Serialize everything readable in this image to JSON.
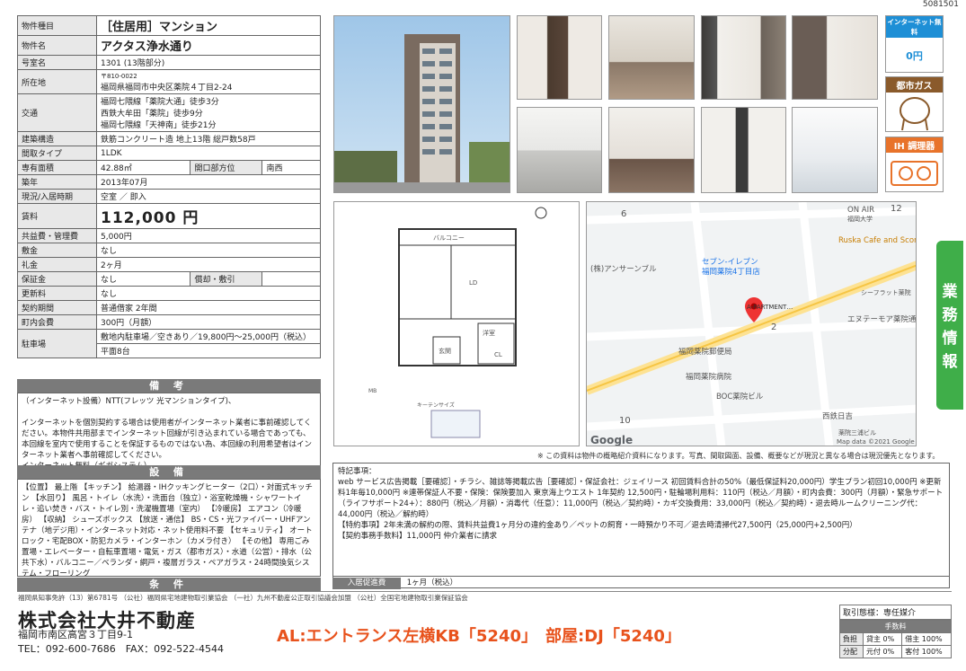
{
  "doc_id": "5081501",
  "spec": {
    "type_label": "物件種目",
    "type_value": "［住居用］マンション",
    "name_label": "物件名",
    "name_value": "アクタス浄水通り",
    "room_label": "号室名",
    "room_value": "1301 (13階部分)",
    "addr_label": "所在地",
    "zip": "〒810-0022",
    "addr_value": "福岡県福岡市中央区薬院４丁目2-24",
    "access_label": "交通",
    "access": [
      "福岡七隈線「薬院大通」徒歩3分",
      "西鉄大牟田「薬院」徒歩9分",
      "福岡七隈線「天神南」徒歩21分"
    ],
    "struct_label": "建築構造",
    "struct_value": "鉄筋コンクリート造 地上13階 総戸数58戸",
    "layout_label": "間取タイプ",
    "layout_value": "1LDK",
    "area_label": "専有面積",
    "area_value": "42.88㎡",
    "face_label": "開口部方位",
    "face_value": "南西",
    "built_label": "築年",
    "built_value": "2013年07月",
    "status_label": "現況/入居時期",
    "status_value": "空室 ／ 即入",
    "rent_label": "賃料",
    "rent_value": "112,000 円",
    "fee_label": "共益費・管理費",
    "fee_value": "5,000円",
    "deposit_label": "敷金",
    "deposit_value": "なし",
    "key_label": "礼金",
    "key_value": "2ヶ月",
    "hosho_label": "保証金",
    "hosho_value": "なし",
    "shokyaku_label": "償却・敷引",
    "shokyaku_value": "",
    "renew_label": "更新料",
    "renew_value": "なし",
    "contract_label": "契約期間",
    "contract_value": "普通借家 2年間",
    "town_label": "町内会費",
    "town_value": "300円（月額）",
    "parking_label": "駐車場",
    "parking_value1": "敷地内駐車場／空きあり／19,800円〜25,000円（税込）",
    "parking_value2": "平面8台"
  },
  "remarks": {
    "title": "備 考",
    "text": "（インターネット設備）NTT(フレッツ 光マンションタイプ)、\n\nインターネットを個別契約する場合は使用者がインターネット業者に事前確認してください。本物件共用部までインターネット回線が引き込まれている場合であっても、本回線を室内で使用することを保証するものではない為、本回線の利用希望者はインターネット業者へ事前確認してください。\nインターネット無料（ギガシステム）"
  },
  "equipment": {
    "title": "設 備",
    "text": "【位置】 最上階 【キッチン】 給湯器・IHクッキングヒーター（2口）・対面式キッチン 【水回り】 風呂・トイレ（水洗）・洗面台（独立）・浴室乾燥機・シャワートイレ・追い焚き・バス・トイレ別・洗濯機置場（室内） 【冷暖房】 エアコン（冷暖房） 【収納】 シューズボックス 【放送・通信】 BS・CS・光ファイバー・UHFアンテナ（地デジ用）・インターネット対応・ネット使用料不要 【セキュリティ】 オートロック・宅配BOX・防犯カメラ・インターホン（カメラ付き） 【その他】 専用ごみ置場・エレベーター・自転車置場・電気・ガス（都市ガス）・水道（公営）・排水（公共下水）・バルコニー／ベランダ・網戸・複層ガラス・ペアガラス・24時間換気システム・フローリング"
  },
  "conditions": {
    "title": "条 件",
    "text": ""
  },
  "badges": {
    "internet": "インターネット無料",
    "internet_price": "0円",
    "gas": "都市ガス",
    "ih": "IH 調理器"
  },
  "side_tab": [
    "業",
    "務",
    "情",
    "報"
  ],
  "map": {
    "labels": [
      "ON AIR",
      "福岡大学",
      "Ruska Cafe and Scones",
      "セブン-イレブン",
      "福岡薬院4丁目店",
      "福岡薬院病院",
      "エヌテーモア薬院通り",
      "シーフラット薬院",
      "福岡薬院郵便局",
      "BOC薬院ビル",
      "西鉄日吉",
      "薬院三浦ビル",
      "12",
      "6",
      "10",
      "2",
      "Google",
      "Map data ©2021 Google",
      "(株)アンサーンブル"
    ],
    "pin": "A-PARTMENT…"
  },
  "floorplan": {
    "labels": [
      "バルコニー",
      "LD",
      "洋室",
      "CL",
      "玄関",
      "キーテンサイズ",
      "MB"
    ]
  },
  "photo_note": "※ この資料は物件の概略紹介資料になります。写真、間取図面、設備、概要などが現況と異なる場合は現況優先となります。",
  "special": {
    "title": "特記事項：",
    "text": "web サービス広告掲載［要確認］・チラシ、雑誌等掲載広告［要確認］・保証会社：ジェイリース 初回賃料合計の50%（最低保証料20,000円）学生プラン初回10,000円 ※更新料1年毎10,000円 ※連帯保証人不要・保険：保険要加入 東京海上ウエスト 1年契約 12,500円・駐輪場利用料：110円（税込／月額）・町内会費：300円（月額）・緊急サポート（ライフサポート24+）：880円（税込／月額）・消毒代（任意）：11,000円（税込／契約時）・カギ交換費用：33,000円（税込／契約時）・退去時ルームクリーニング代：44,000円（税込／解約時）\n【特約事項】2年未満の解約の際、賃料共益費1ヶ月分の違約金あり／ペットの飼育・一時預かり不可／退去時清掃代27,500円（25,000円+2,500円）\n【契約事務手数料】11,000円 仲介業者に請求"
  },
  "fee": {
    "label": "入居促進費",
    "value": "1ヶ月（税込）"
  },
  "footer": {
    "assoc": "福岡県知事免許（13）第6781号 （公社）福岡県宅地建物取引業協会 （一社）九州不動産公正取引協議会加盟 （公社）全国宅地建物取引業保証協会",
    "company": "株式会社大井不動産",
    "address": "福岡市南区高宮３丁目9-1",
    "tel": "TEL：092-600-7686　FAX：092-522-4544",
    "keyinfo": "AL:エントランス左横KB「5240」　部屋:DJ「5240」"
  },
  "deal": {
    "mode": "取引態様：専任媒介",
    "fee_title": "手数料",
    "rows": [
      [
        "負担",
        "貸主 0%",
        "借主 100%"
      ],
      [
        "分配",
        "元付 0%",
        "客付 100%"
      ]
    ]
  },
  "colors": {
    "accent": "#e8521c",
    "green": "#3fae49",
    "header_gray": "#7a7a7a",
    "badge_blue": "#1e8fd6",
    "badge_brown": "#8a5a2b",
    "badge_orange": "#e8732a"
  }
}
